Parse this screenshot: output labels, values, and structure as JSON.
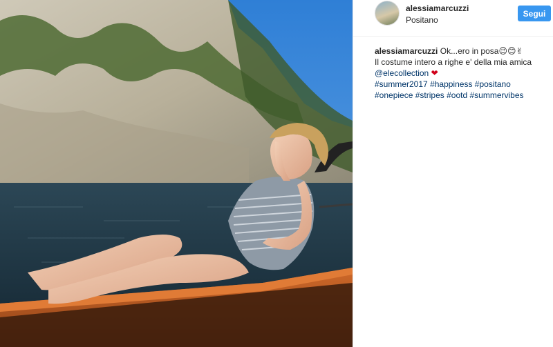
{
  "post": {
    "username": "alessiamarcuzzi",
    "location": "Positano",
    "follow_label": "Segui",
    "caption": {
      "username": "alessiamarcuzzi",
      "line1": "Ok...ero in posa",
      "line1_emojis": "😉😊✌",
      "line2": "Il costume intero a righe e' della mia amica",
      "mention": "@elecollection",
      "heart": "❤",
      "hashtags_line1": [
        "#summer2017",
        "#happiness",
        "#positano"
      ],
      "hashtags_line2": [
        "#onepiece",
        "#stripes",
        "#ootd",
        "#summervibes"
      ]
    }
  },
  "colors": {
    "follow_button": "#3897f0",
    "hashtag": "#003569",
    "heart": "#d0021b",
    "border": "#efefef"
  }
}
